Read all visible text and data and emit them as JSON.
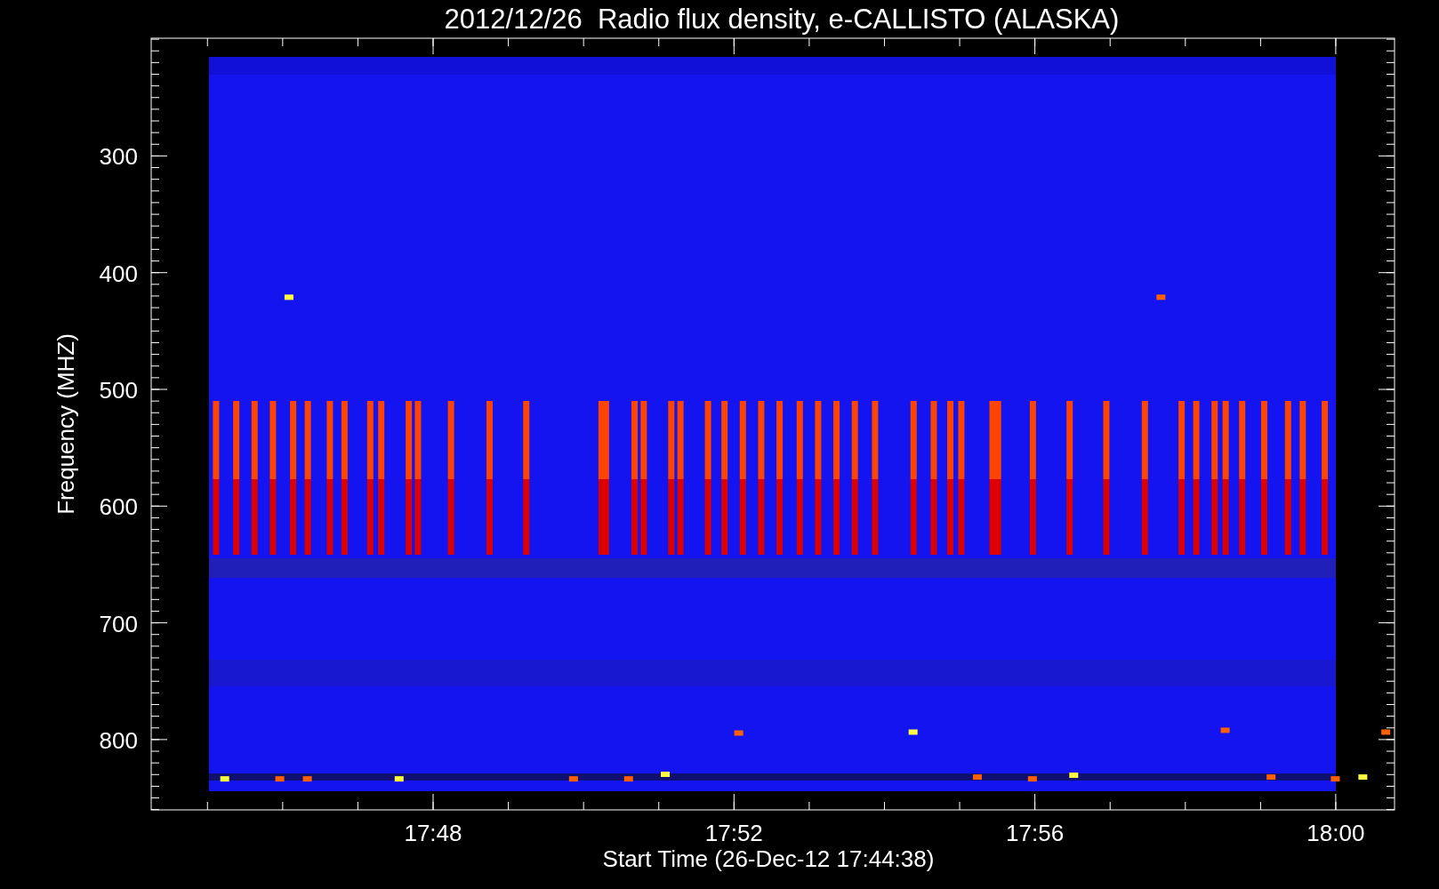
{
  "plot": {
    "title": "2012/12/26  Radio flux density, e-CALLISTO (ALASKA)",
    "ylabel": "Frequency (MHZ)",
    "xlabel": "Start Time (26-Dec-12 17:44:38)",
    "yticks": [
      "300",
      "400",
      "500",
      "600",
      "700",
      "800"
    ],
    "xticks": [
      "17:48",
      "17:52",
      "17:56",
      "18:00"
    ]
  }
}
